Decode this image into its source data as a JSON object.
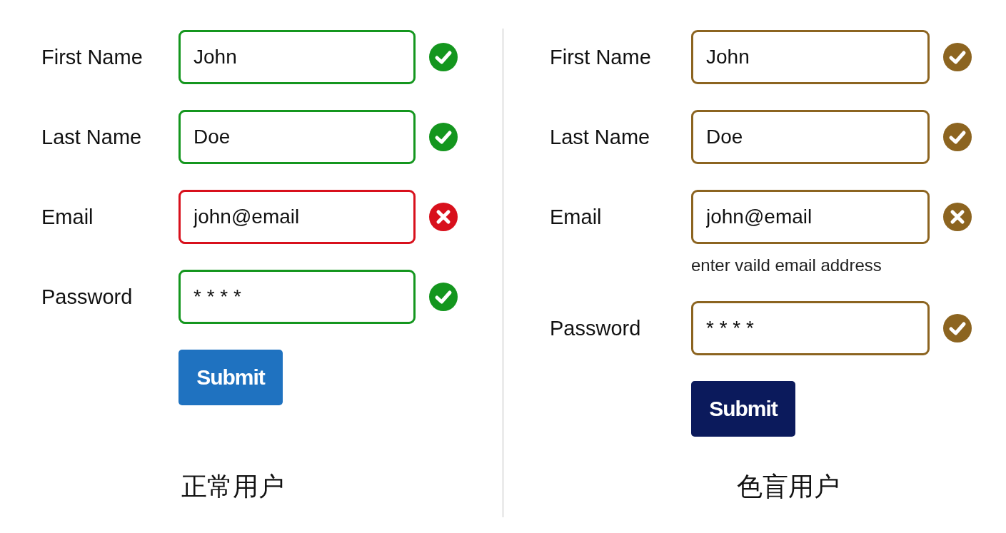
{
  "panels": [
    {
      "kind": "normal",
      "caption": "正常用户",
      "fields": [
        {
          "label": "First Name",
          "value": "John",
          "valid": true,
          "color": "#14961e"
        },
        {
          "label": "Last Name",
          "value": "Doe",
          "valid": true,
          "color": "#14961e"
        },
        {
          "label": "Email",
          "value": "john@email",
          "valid": false,
          "color": "#d8101c"
        },
        {
          "label": "Password",
          "value": "* * * *",
          "valid": true,
          "color": "#14961e"
        }
      ],
      "submit": {
        "label": "Submit",
        "color": "#1f72c0"
      }
    },
    {
      "kind": "colorblind",
      "caption": "色盲用户",
      "fields": [
        {
          "label": "First Name",
          "value": "John",
          "valid": true,
          "color": "#8c6420"
        },
        {
          "label": "Last Name",
          "value": "Doe",
          "valid": true,
          "color": "#8c6420"
        },
        {
          "label": "Email",
          "value": "john@email",
          "valid": false,
          "color": "#8c6420",
          "error": "enter vaild email address"
        },
        {
          "label": "Password",
          "value": "* * * *",
          "valid": true,
          "color": "#8c6420"
        }
      ],
      "submit": {
        "label": "Submit",
        "color": "#0b1a5c"
      }
    }
  ]
}
